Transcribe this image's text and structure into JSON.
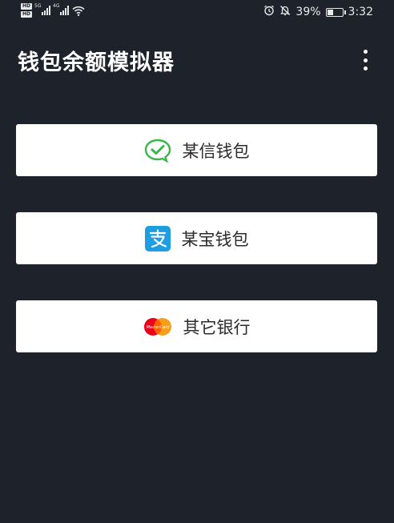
{
  "status_bar": {
    "hd_badge_1": "HD",
    "hd_badge_2": "HD",
    "network_1": "5G",
    "network_2": "4G",
    "battery_percent": "39%",
    "battery_level": 0.39,
    "time": "3:32",
    "icons": [
      "signal-icon",
      "wifi-icon",
      "alarm-icon",
      "mute-icon",
      "battery-icon"
    ]
  },
  "app_bar": {
    "title": "钱包余额模拟器",
    "menu_icon": "more-vert-icon"
  },
  "options": [
    {
      "label": "某信钱包",
      "icon": "wechat-pay-icon",
      "icon_color": "#3cb54a"
    },
    {
      "label": "某宝钱包",
      "icon": "alipay-icon",
      "icon_color": "#1e9ee0"
    },
    {
      "label": "其它银行",
      "icon": "mastercard-icon",
      "icon_color": "#eb001b"
    }
  ],
  "mastercard_text": "MasterCard",
  "colors": {
    "background": "#1d222b",
    "button_bg": "#ffffff",
    "button_text": "#2b2b2b"
  }
}
